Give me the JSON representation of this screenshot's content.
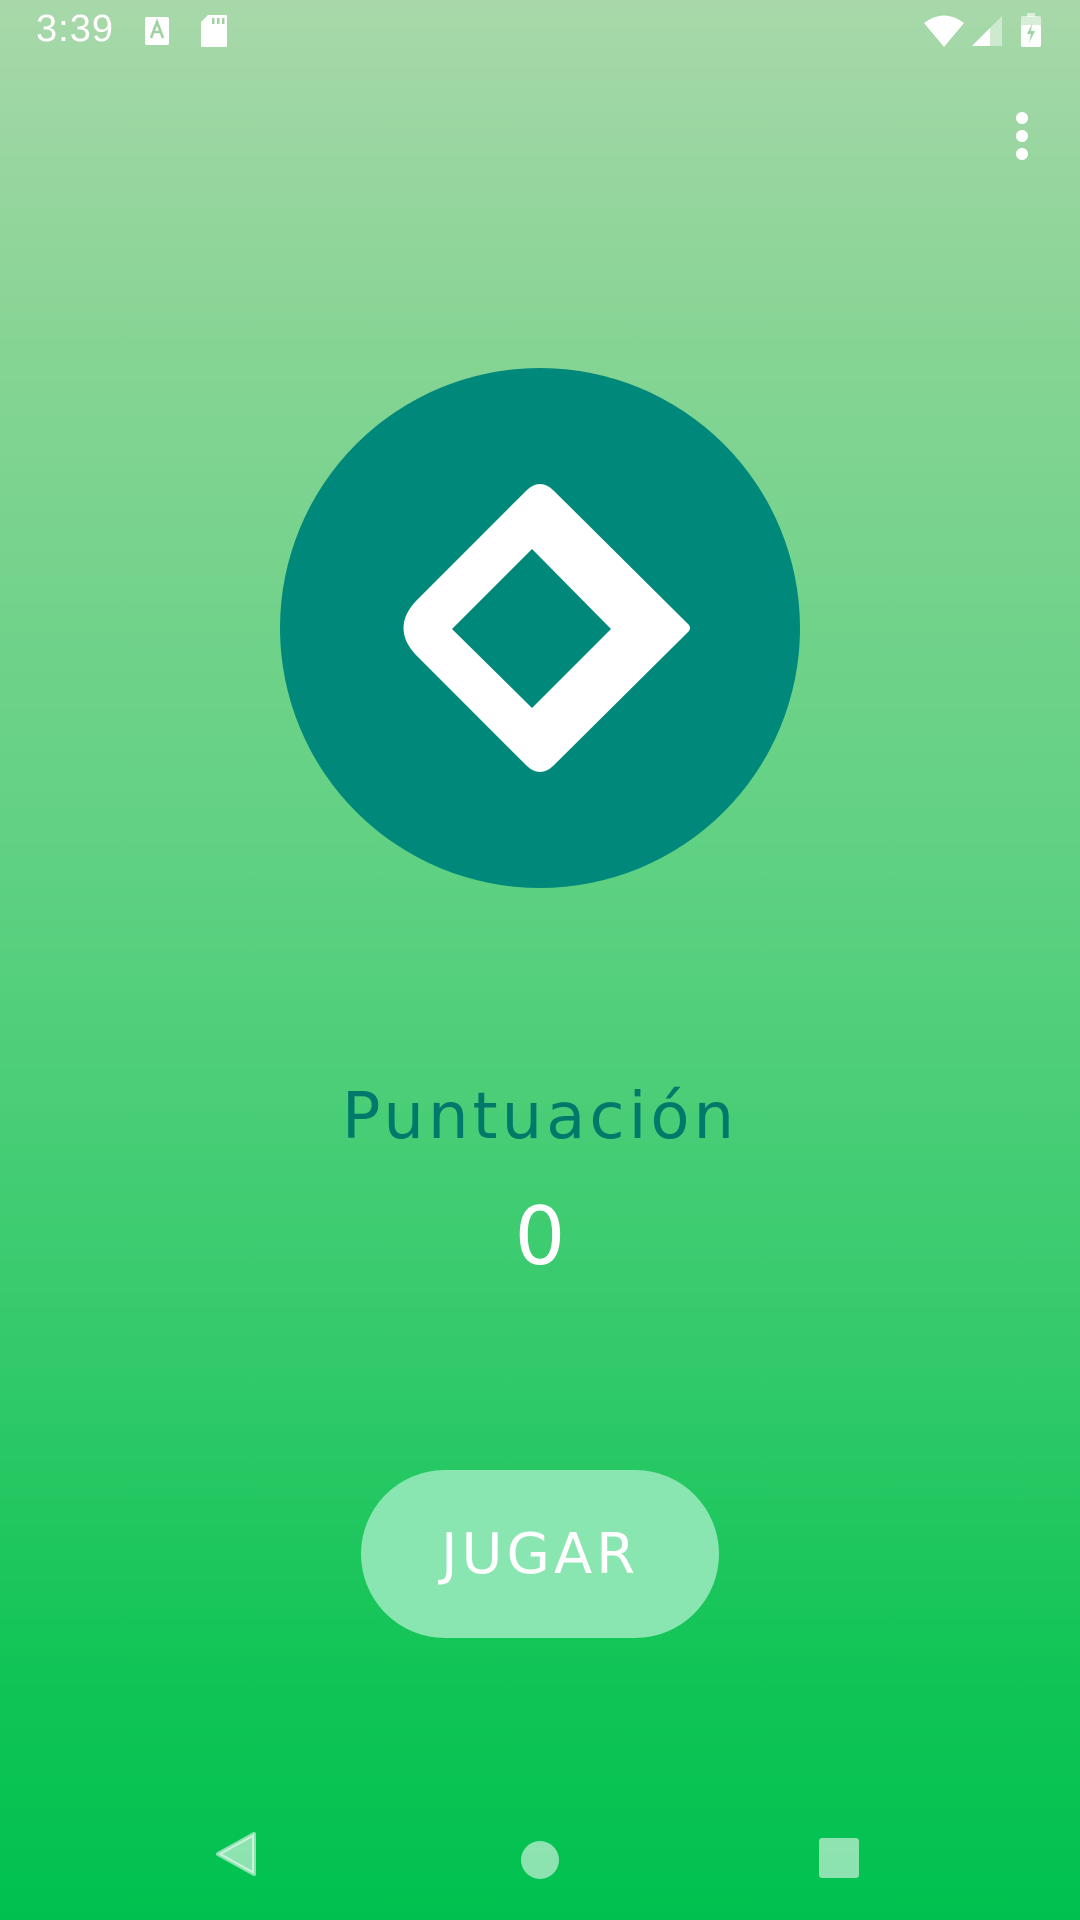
{
  "status_bar": {
    "time": "3:39",
    "left_icons": [
      "font-a-icon",
      "sd-card-icon"
    ],
    "right_icons": [
      "wifi-icon",
      "cell-signal-icon",
      "battery-charging-icon"
    ]
  },
  "app_bar": {
    "overflow_icon": "more-vert-icon"
  },
  "logo": {
    "icon": "diamond-logo-icon",
    "circle_color": "#00897b",
    "shape_color": "#ffffff"
  },
  "score": {
    "label": "Puntuación",
    "value": "0"
  },
  "play_button": {
    "label": "JUGAR",
    "color": "#8ae6b0"
  },
  "nav_bar": {
    "icons": [
      "back-icon",
      "home-icon",
      "recents-icon"
    ]
  },
  "colors": {
    "gradient_top": "#a8d8aa",
    "gradient_bottom": "#00c150",
    "score_label": "#00796b"
  }
}
